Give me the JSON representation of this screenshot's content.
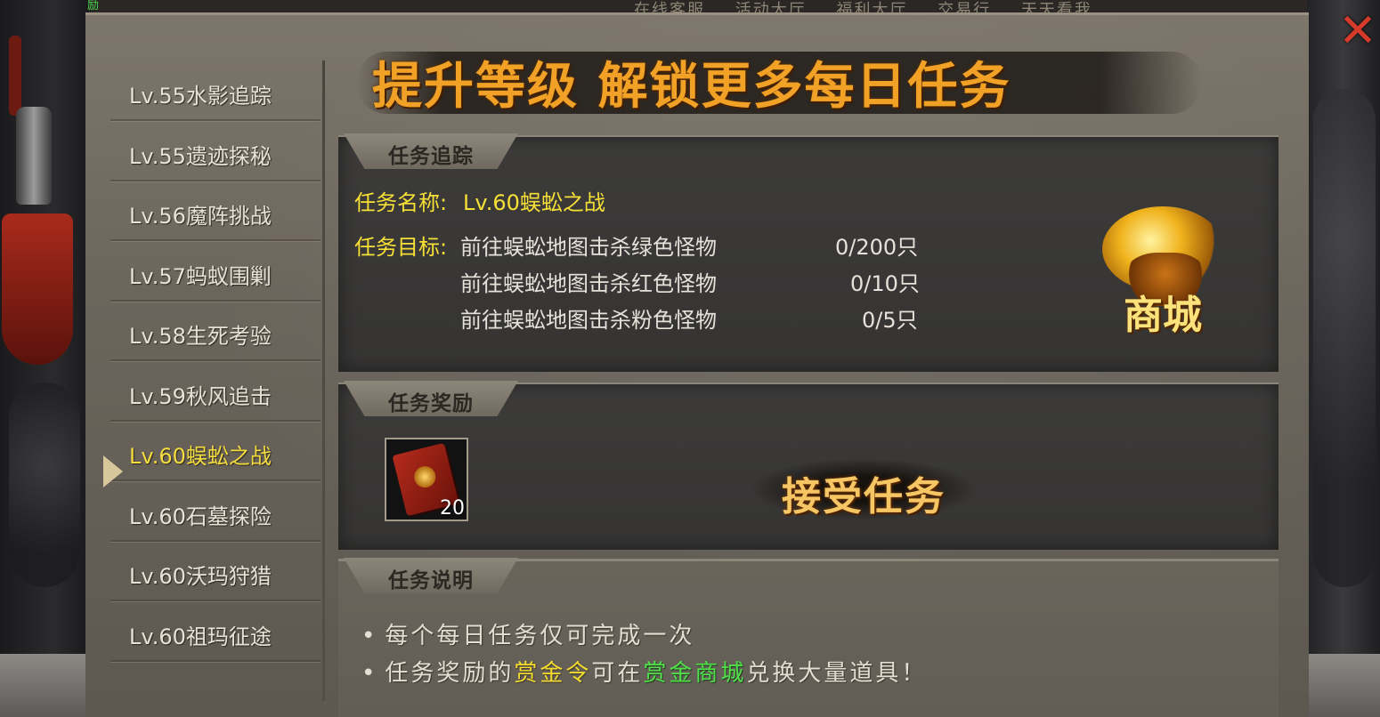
{
  "topbar": {
    "tag": "励",
    "links": [
      "在线客服",
      "活动大厅",
      "福利大厅",
      "交易行",
      "天天看我"
    ]
  },
  "banner": {
    "title": "提升等级 解锁更多每日任务"
  },
  "sidebar": {
    "items": [
      {
        "label": "Lv.55水影追踪",
        "active": false
      },
      {
        "label": "Lv.55遗迹探秘",
        "active": false
      },
      {
        "label": "Lv.56魔阵挑战",
        "active": false
      },
      {
        "label": "Lv.57蚂蚁围剿",
        "active": false
      },
      {
        "label": "Lv.58生死考验",
        "active": false
      },
      {
        "label": "Lv.59秋风追击",
        "active": false
      },
      {
        "label": "Lv.60蜈蚣之战",
        "active": true
      },
      {
        "label": "Lv.60石墓探险",
        "active": false
      },
      {
        "label": "Lv.60沃玛狩猎",
        "active": false
      },
      {
        "label": "Lv.60祖玛征途",
        "active": false
      }
    ]
  },
  "tracking": {
    "tab": "任务追踪",
    "name_label": "任务名称:",
    "name_value": "Lv.60蜈蚣之战",
    "goal_label": "任务目标:",
    "goals": [
      {
        "text": "前往蜈蚣地图击杀绿色怪物",
        "progress": "0/200只"
      },
      {
        "text": "前往蜈蚣地图击杀红色怪物",
        "progress": "0/10只"
      },
      {
        "text": "前往蜈蚣地图击杀粉色怪物",
        "progress": "0/5只"
      }
    ],
    "shop_label": "商城"
  },
  "reward": {
    "tab": "任务奖励",
    "item_count": "20",
    "accept_label": "接受任务"
  },
  "description": {
    "tab": "任务说明",
    "line1": "每个每日任务仅可完成一次",
    "line2_a": "任务奖励的",
    "line2_b": "赏金令",
    "line2_c": "可在",
    "line2_d": "赏金商城",
    "line2_e": "兑换大量道具！",
    "bullet": "•"
  },
  "close_label": "✕",
  "colors": {
    "accent_yellow": "#f6e036",
    "banner_orange": "#f0a126",
    "highlight_green": "#51e04a",
    "close_red": "#d63a2a"
  }
}
